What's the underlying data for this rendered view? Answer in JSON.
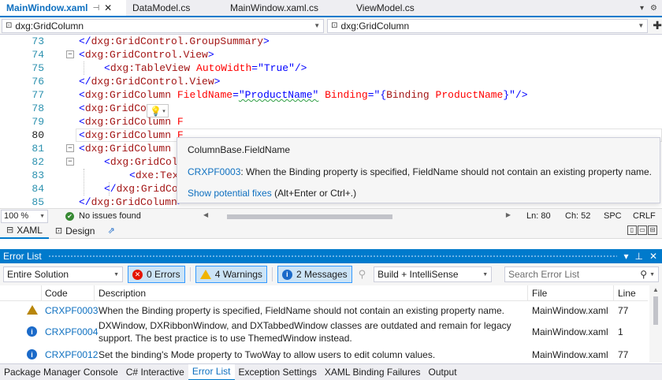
{
  "tabs": [
    {
      "label": "MainWindow.xaml",
      "active": true,
      "pinned": true
    },
    {
      "label": "DataModel.cs",
      "active": false
    },
    {
      "label": "MainWindow.xaml.cs",
      "active": false
    },
    {
      "label": "ViewModel.cs",
      "active": false
    }
  ],
  "navbar": {
    "left_selector": "dxg:GridColumn",
    "right_selector": "dxg:GridColumn"
  },
  "editor": {
    "current_line": 80,
    "lines": [
      {
        "num": "73",
        "text": "</dxg:GridControl.GroupSummary>"
      },
      {
        "num": "74",
        "text": "<dxg:GridControl.View>"
      },
      {
        "num": "75",
        "text": "<dxg:TableView AutoWidth=\"True\"/>"
      },
      {
        "num": "76",
        "text": "</dxg:GridControl.View>"
      },
      {
        "num": "77",
        "text": "<dxg:GridColumn FieldName=\"ProductName\" Binding=\"{Binding ProductName}\"/>"
      },
      {
        "num": "78",
        "text": "<dxg:GridCo"
      },
      {
        "num": "79",
        "text": "<dxg:GridColumn F"
      },
      {
        "num": "80",
        "text": "<dxg:GridColumn F"
      },
      {
        "num": "81",
        "text": "<dxg:GridColumn F"
      },
      {
        "num": "82",
        "text": "<dxg:GridColu"
      },
      {
        "num": "83",
        "text": "<dxe:TextEditSettings MaskUseAsDisplayFormat=\"True\" Mask=\"c\" MaskType=\"Numeric\"/>"
      },
      {
        "num": "84",
        "text": "</dxg:GridColumn.EditSettings>"
      },
      {
        "num": "85",
        "text": "</dxg:GridColumn>"
      }
    ]
  },
  "tooltip": {
    "title": "ColumnBase.FieldName",
    "code": "CRXPF0003",
    "message": ": When the Binding property is specified, FieldName should not contain an existing property name.",
    "fix_link": "Show potential fixes",
    "fix_shortcut": " (Alt+Enter or Ctrl+.)"
  },
  "editor_status": {
    "zoom": "100 %",
    "issues": "No issues found",
    "line": "Ln: 80",
    "char": "Ch: 52",
    "mode": "SPC",
    "eol": "CRLF"
  },
  "view_tabs": {
    "xaml": "XAML",
    "design": "Design"
  },
  "error_list": {
    "title": "Error List",
    "scope": "Entire Solution",
    "errors_label": "0 Errors",
    "warnings_label": "4 Warnings",
    "messages_label": "2 Messages",
    "build_filter": "Build + IntelliSense",
    "search_placeholder": "Search Error List",
    "columns": {
      "code": "Code",
      "description": "Description",
      "file": "File",
      "line": "Line"
    },
    "rows": [
      {
        "type": "warning",
        "code": "CRXPF0003",
        "description": "When the Binding property is specified, FieldName should not contain an existing property name.",
        "description2": "",
        "file": "MainWindow.xaml",
        "line": "77"
      },
      {
        "type": "info",
        "code": "CRXPF0004",
        "description": "DXWindow, DXRibbonWindow, and DXTabbedWindow classes are outdated and remain for legacy",
        "description2": "support. The best practice is to use ThemedWindow instead.",
        "file": "MainWindow.xaml",
        "line": "1"
      },
      {
        "type": "info",
        "code": "CRXPF0012",
        "description": "Set the binding's Mode property to TwoWay to allow users to edit column values.",
        "description2": "",
        "file": "MainWindow.xaml",
        "line": "77"
      }
    ]
  },
  "bottom_tabs": [
    {
      "label": "Package Manager Console",
      "active": false
    },
    {
      "label": "C# Interactive",
      "active": false
    },
    {
      "label": "Error List",
      "active": true
    },
    {
      "label": "Exception Settings",
      "active": false
    },
    {
      "label": "XAML Binding Failures",
      "active": false
    },
    {
      "label": "Output",
      "active": false
    }
  ],
  "colors": {
    "accent": "#007acc",
    "link": "#0e70c0",
    "xml_tag": "#a31515",
    "xml_attr": "#ff0000",
    "xml_punc": "#0000ff",
    "error": "#e51400",
    "warning": "#f0b400",
    "info": "#1b6ac9"
  }
}
